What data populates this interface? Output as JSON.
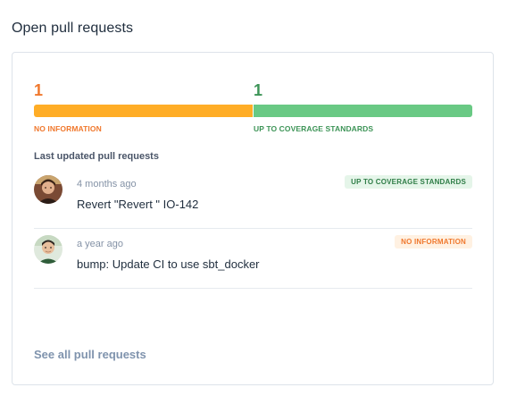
{
  "section_title": "Open pull requests",
  "coverage_summary": {
    "no_information": {
      "count": "1",
      "label": "NO INFORMATION",
      "share": 0.5,
      "color": "#ffad26"
    },
    "up_to_standards": {
      "count": "1",
      "label": "UP TO COVERAGE STANDARDS",
      "share": 0.5,
      "color": "#69c984"
    }
  },
  "list_title": "Last updated pull requests",
  "pull_requests": [
    {
      "time": "4 months ago",
      "title": "Revert \"Revert \" IO-142",
      "status": "UP TO COVERAGE STANDARDS",
      "avatar_icon": "user-avatar-icon"
    },
    {
      "time": "a year ago",
      "title": "bump: Update CI to use sbt_docker",
      "status": "NO INFORMATION",
      "avatar_icon": "user-avatar-icon"
    }
  ],
  "see_all_label": "See all pull requests"
}
